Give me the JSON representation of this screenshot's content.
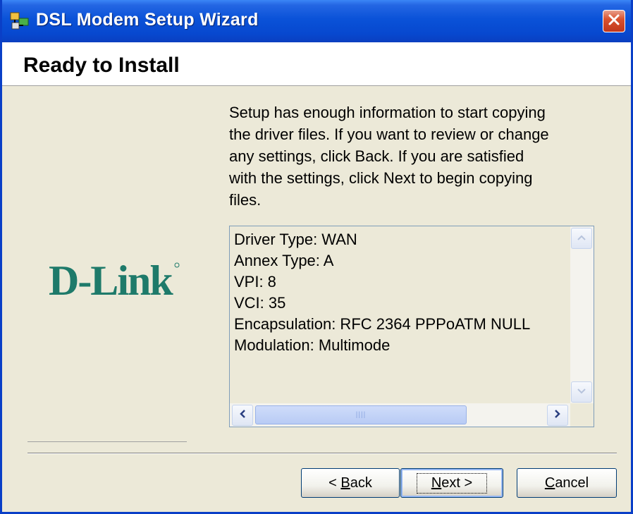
{
  "window": {
    "title": "DSL Modem Setup Wizard",
    "icon": "network-setup-icon",
    "close": "close-icon"
  },
  "header": {
    "title": "Ready to Install"
  },
  "logo": {
    "text": "D-Link",
    "color": "#1e7a6a"
  },
  "description": [
    "Setup has enough information to start copying",
    "the driver files.  If you want to review or change",
    "any settings, click Back.  If you are satisfied",
    "with the settings, click Next to begin copying",
    "files."
  ],
  "settings": [
    "Driver Type: WAN",
    "Annex Type: A",
    "VPI: 8",
    "VCI: 35",
    "Encapsulation: RFC 2364 PPPoATM NULL",
    "Modulation: Multimode"
  ],
  "buttons": {
    "back_prefix": "< ",
    "back_mnemonic": "B",
    "back_rest": "ack",
    "next_mnemonic": "N",
    "next_rest": "ext >",
    "cancel_mnemonic": "C",
    "cancel_rest": "ancel"
  }
}
